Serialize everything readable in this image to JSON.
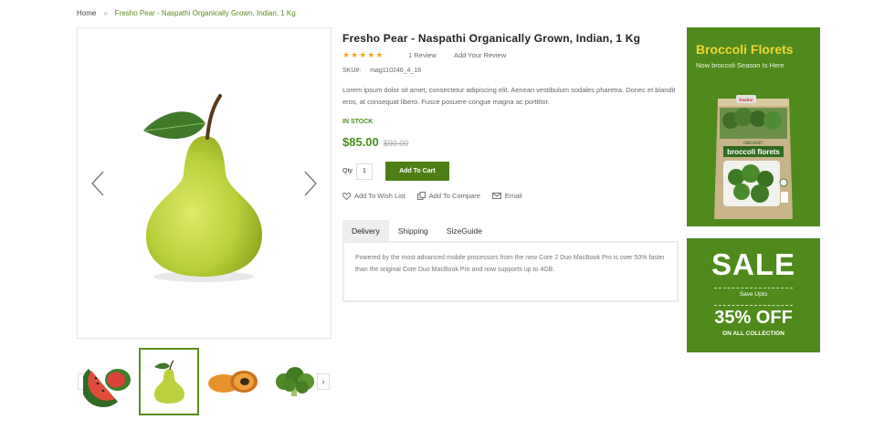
{
  "breadcrumb": {
    "home": "Home",
    "separator": "»",
    "current": "Fresho Pear - Naspathi Organically Grown, Indian, 1 Kg"
  },
  "product": {
    "title": "Fresho Pear - Naspathi Organically Grown, Indian, 1 Kg",
    "rating": 5,
    "stars": "★★★★★",
    "review_count": "1 Review",
    "add_review": "Add Your Review",
    "sku_label": "SKU#:",
    "sku_value": "mag110246_4_16",
    "description": "Lorem ipsum dolor sit amet, consectetur adipiscing elit. Aenean vestibulum sodales pharetra. Donec et blandit eros, at consequat libero. Fusce posuere congue magna ac porttitor.",
    "stock": "IN STOCK",
    "price": "$85.00",
    "old_price": "$90.00",
    "qty_label": "Qty",
    "qty_value": "1",
    "add_to_cart": "Add To Cart",
    "wishlist": "Add To Wish List",
    "compare": "Add To Compare",
    "email": "Email"
  },
  "gallery": {
    "main_image": "pear",
    "thumbnails": [
      "watermelon",
      "pear",
      "papaya",
      "broccoli"
    ],
    "active_thumbnail": 1
  },
  "tabs": {
    "items": [
      "Delivery",
      "Shipping",
      "SizeGuide"
    ],
    "active": 0,
    "content": "Powered by the most advanced mobile processors from the new Core 2 Duo MacBook Pro is over 50% faster than the original Core Duo MacBook Pro and now supports up to 4GB."
  },
  "ads": {
    "broccoli": {
      "title": "Broccoli Florets",
      "subtitle": "Now broccoli Season Is Here",
      "bag_brand": "fresho!",
      "bag_organic": "ORGANIC",
      "bag_label": "broccoli florets"
    },
    "sale": {
      "title": "SALE",
      "save_upto": "Save Upto",
      "discount": "35% OFF",
      "collection": "ON ALL COLLECTION"
    }
  },
  "colors": {
    "accent_green": "#4e7f17",
    "stock_green": "#4a8d1a",
    "ad_background": "#4f8a1c",
    "ad_title_yellow": "#f2d630",
    "star": "#f5a623"
  }
}
